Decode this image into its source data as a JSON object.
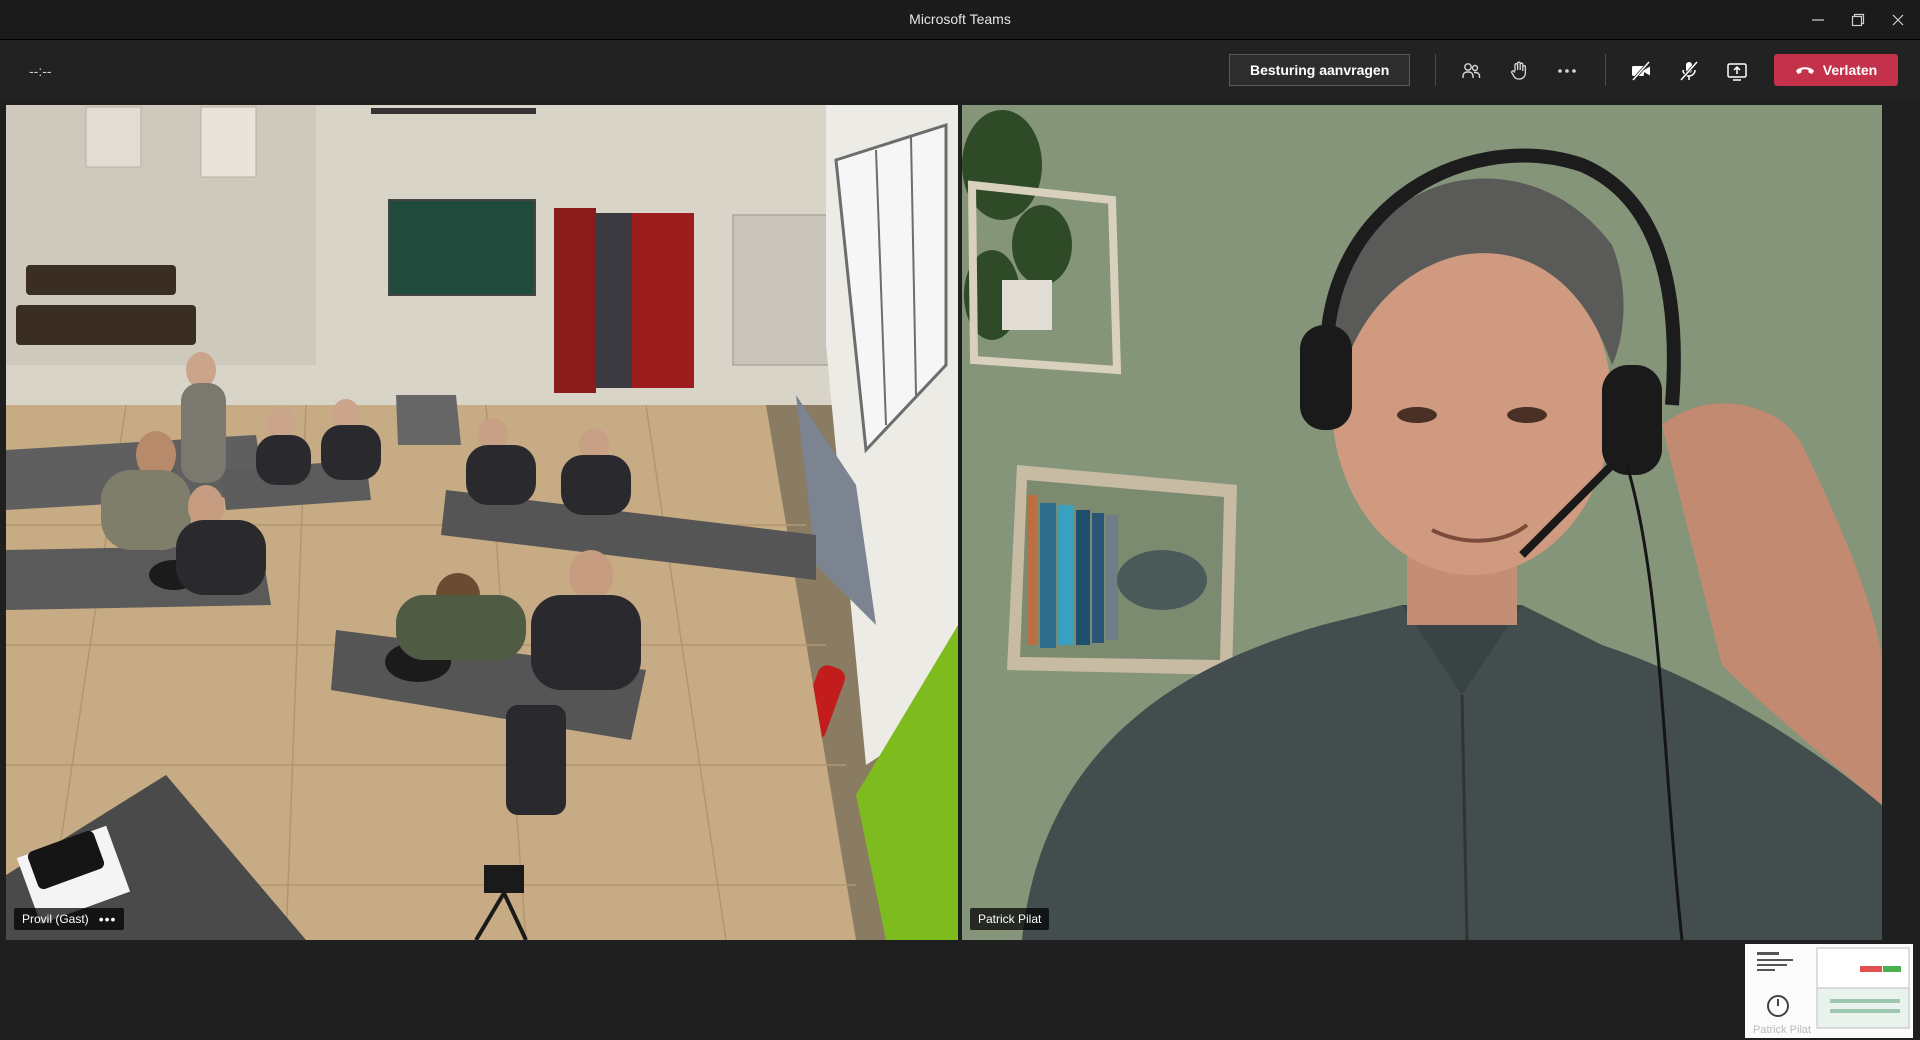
{
  "window": {
    "title": "Microsoft Teams"
  },
  "toolbar": {
    "timer": "--:--",
    "request_control_label": "Besturing aanvragen",
    "leave_label": "Verlaten",
    "icons": [
      "participants-icon",
      "raise-hand-icon",
      "more-options-icon",
      "camera-off-icon",
      "mic-off-icon",
      "share-screen-icon"
    ],
    "leave_color": "#c4314b"
  },
  "participants": [
    {
      "name": "Provil (Gast)",
      "more": "•••"
    },
    {
      "name": "Patrick Pilat"
    }
  ],
  "thumbnail": {
    "name": "Patrick Pilat"
  }
}
